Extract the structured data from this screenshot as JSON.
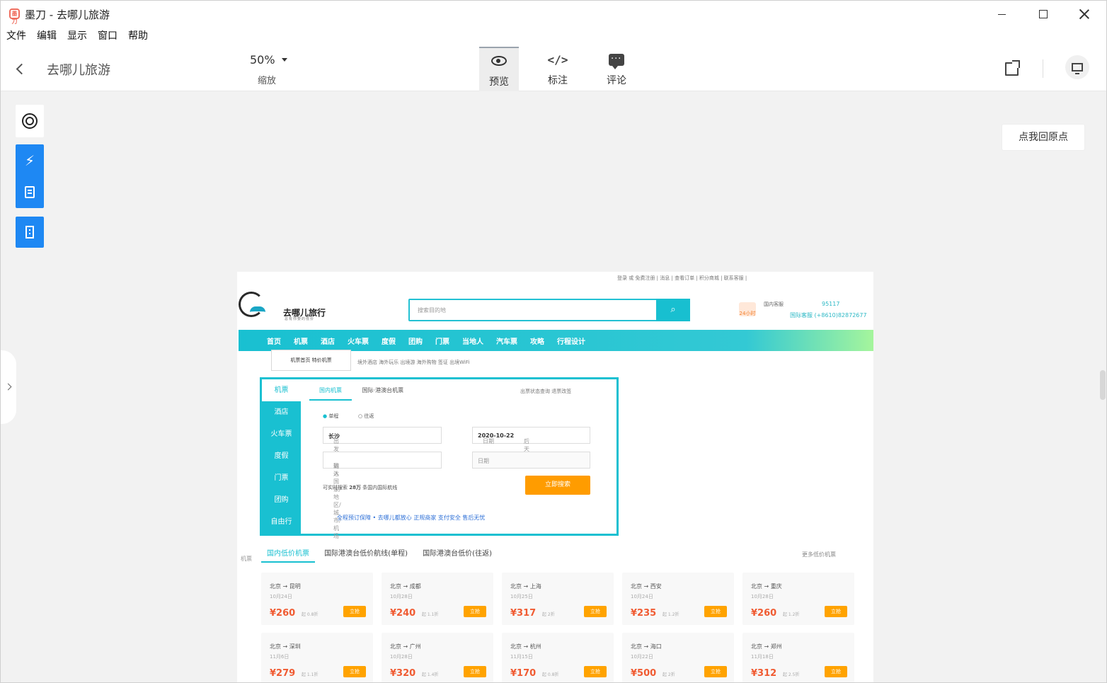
{
  "window": {
    "title": "墨刀 - 去哪儿旅游",
    "logo": "墨刀",
    "icons": {
      "minimize": "minimize-icon",
      "maximize": "maximize-icon",
      "close": "close-icon"
    }
  },
  "menu": [
    "文件",
    "编辑",
    "显示",
    "窗口",
    "帮助"
  ],
  "toolbar": {
    "project": "去哪儿旅游",
    "zoom": "50%",
    "zoom_label": "缩放",
    "tabs": [
      {
        "label": "预览",
        "icon": "eye-icon"
      },
      {
        "label": "标注",
        "icon": "code-icon"
      },
      {
        "label": "评论",
        "icon": "comment-icon"
      }
    ],
    "active_tab": "预览"
  },
  "left_tools": {
    "target": "target-icon",
    "lightning": "⚡",
    "doc": "document-icon",
    "page": "page-icon"
  },
  "origin_button": "点我回原点",
  "artboard": {
    "top_nav": "登录 或 免费注册  |  消息  |  查看订单  |  积分商城  |  联系客服  |",
    "brand": "去哪儿旅行",
    "brand_sub": "总有你要的低价",
    "search_placeholder": "搜索目的地",
    "search_icon": "⌕",
    "service": "国内客服",
    "service_phone": "95117",
    "service_label": "24小时",
    "intl_service": "国际客服 (+8610)82872677",
    "main_nav": [
      "首页",
      "机票",
      "酒店",
      "火车票",
      "度假",
      "团购",
      "门票",
      "当地人",
      "汽车票",
      "攻略",
      "行程设计"
    ],
    "fly_menu": "机票首页  特价机票",
    "sub_nav": "境外酒店   海外玩乐   出境游   海外购物   签证   出境WiFi",
    "panel_left": [
      "机票",
      "酒店",
      "火车票",
      "度假",
      "门票",
      "团购",
      "自由行"
    ],
    "panel_tabs": [
      "国内机票",
      "国际·港澳台机票"
    ],
    "panel_links": "出票状态查询   退票改签",
    "radio": [
      "单程",
      "往返"
    ],
    "from_label": "出发",
    "from_value": "长沙",
    "to_label": "到达",
    "to_placeholder": "输入国家/地区/城市/机场",
    "date_label": "日期",
    "date_value": "2020-10-22",
    "date_hint": "后天",
    "return_label": "日期",
    "routes_text": "可实时搜索",
    "routes_count": "28万",
    "routes_tail": "条国内国际航线",
    "search_button": "立即搜索",
    "trust": "全程预订保障 • 去哪儿都放心   正规商家   支付安全   售后无忧",
    "hot_tabs": [
      "国内低价机票",
      "国际港澳台低价航线(单程)",
      "国际港澳台低价(往返)"
    ],
    "more": "更多低价机票",
    "side_mini": [
      "机票",
      "",
      "",
      "",
      "",
      ""
    ],
    "cards": [
      {
        "route": "北京 → 昆明",
        "date": "10月24日",
        "price": "¥260",
        "discount": "起 0.8折",
        "book": "立抢"
      },
      {
        "route": "北京 → 成都",
        "date": "10月28日",
        "price": "¥240",
        "discount": "起 1.1折",
        "book": "立抢"
      },
      {
        "route": "北京 → 上海",
        "date": "10月25日",
        "price": "¥317",
        "discount": "起 2折",
        "book": "立抢"
      },
      {
        "route": "北京 → 西安",
        "date": "10月24日",
        "price": "¥235",
        "discount": "起 1.2折",
        "book": "立抢"
      },
      {
        "route": "北京 → 重庆",
        "date": "10月28日",
        "price": "¥260",
        "discount": "起 1.2折",
        "book": "立抢"
      },
      {
        "route": "北京 → 深圳",
        "date": "11月6日",
        "price": "¥279",
        "discount": "起 1.1折",
        "book": "立抢"
      },
      {
        "route": "北京 → 广州",
        "date": "10月28日",
        "price": "¥320",
        "discount": "起 1.4折",
        "book": "立抢"
      },
      {
        "route": "北京 → 杭州",
        "date": "11月15日",
        "price": "¥170",
        "discount": "起 0.8折",
        "book": "立抢"
      },
      {
        "route": "北京 → 海口",
        "date": "10月22日",
        "price": "¥500",
        "discount": "起 2折",
        "book": "立抢"
      },
      {
        "route": "北京 → 郑州",
        "date": "11月18日",
        "price": "¥312",
        "discount": "起 2.5折",
        "book": "立抢"
      }
    ]
  }
}
